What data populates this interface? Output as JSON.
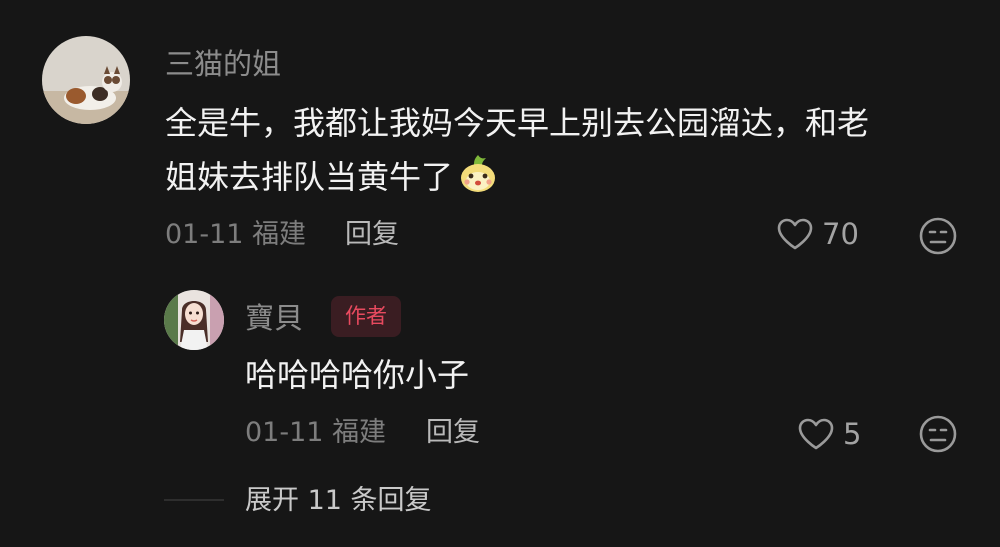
{
  "comment": {
    "username": "三猫的姐",
    "text_line1": "全是牛，我都让我妈今天早上别去公园溜达，和老",
    "text_line2": "姐妹去排队当黄牛了",
    "emoji": "pear-face-emoji",
    "date": "01-11",
    "location": "福建",
    "reply_label": "回复",
    "like_count": "70"
  },
  "reply": {
    "username": "寶貝",
    "badge": "作者",
    "text": "哈哈哈哈你小子",
    "date": "01-11",
    "location": "福建",
    "reply_label": "回复",
    "like_count": "5"
  },
  "expand_label": "展开 11 条回复",
  "colors": {
    "background": "#161616",
    "badge_text": "#e84a5f",
    "badge_bg": "#3a1d22"
  }
}
